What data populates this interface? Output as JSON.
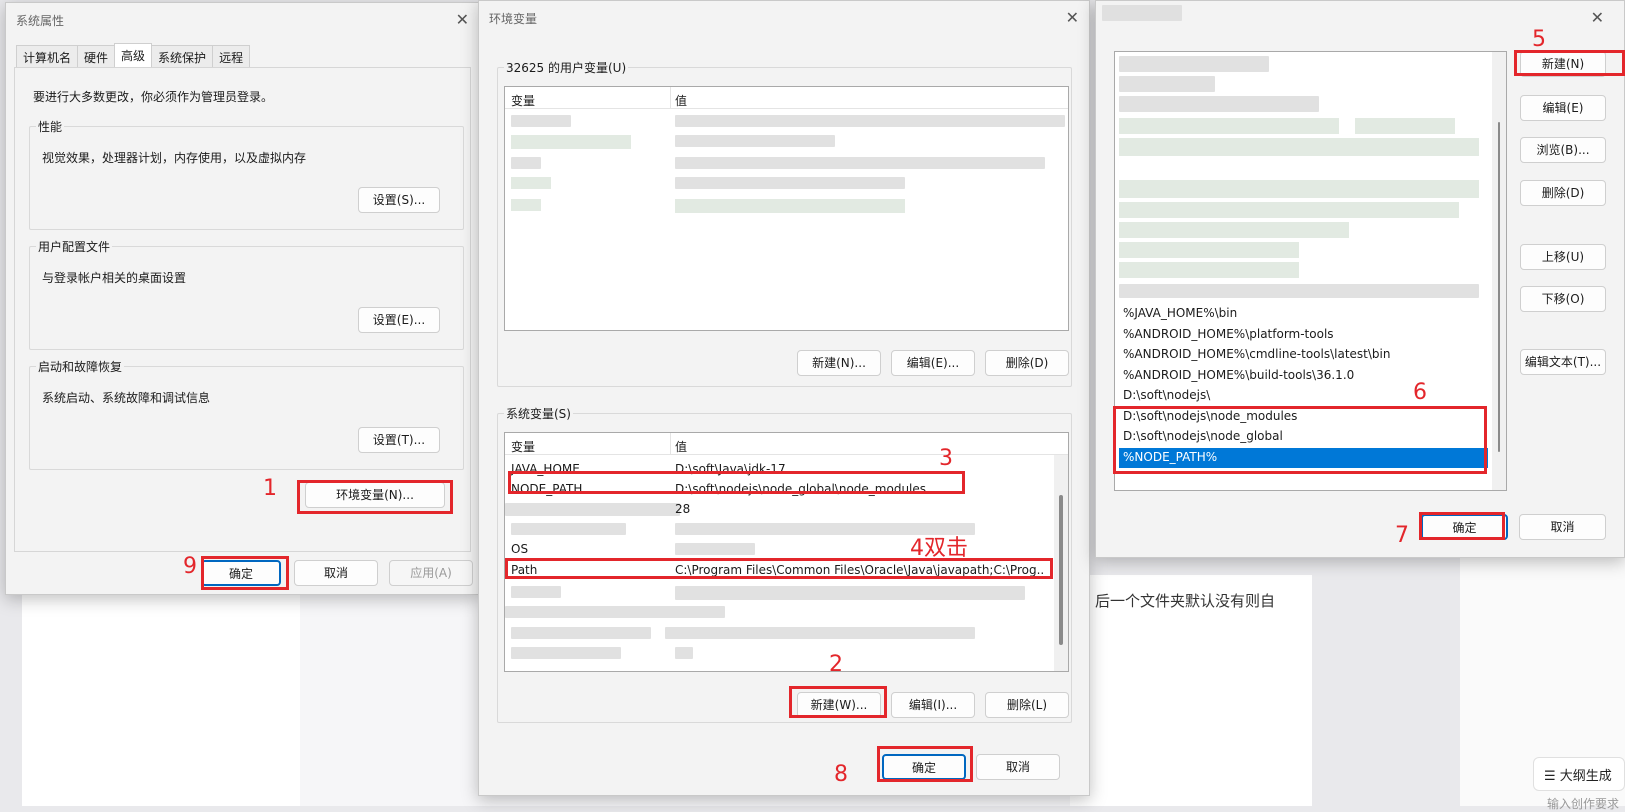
{
  "background": {
    "article_fragment": "后一个文件夹默认没有则自",
    "outline_button": "大纲生成",
    "outline_input": "输入创作要求"
  },
  "sysprops": {
    "title": "系统属性",
    "tabs": [
      "计算机名",
      "硬件",
      "高级",
      "系统保护",
      "远程"
    ],
    "notice": "要进行大多数更改，你必须作为管理员登录。",
    "perf": {
      "label": "性能",
      "desc": "视觉效果，处理器计划，内存使用，以及虚拟内存",
      "button": "设置(S)..."
    },
    "profile": {
      "label": "用户配置文件",
      "desc": "与登录帐户相关的桌面设置",
      "button": "设置(E)..."
    },
    "startup": {
      "label": "启动和故障恢复",
      "desc": "系统启动、系统故障和调试信息",
      "button": "设置(T)..."
    },
    "env_button": "环境变量(N)...",
    "ok": "确定",
    "cancel": "取消",
    "apply": "应用(A)"
  },
  "envvars": {
    "title": "环境变量",
    "user_group": "32625 的用户变量(U)",
    "sys_group": "系统变量(S)",
    "col_var": "变量",
    "col_val": "值",
    "user_buttons": [
      "新建(N)...",
      "编辑(E)...",
      "删除(D)"
    ],
    "sys_rows": [
      {
        "var": "JAVA_HOME",
        "val": "D:\\soft\\Java\\jdk-17"
      },
      {
        "var": "NODE_PATH",
        "val": "D:\\soft\\nodejs\\node_global\\node_modules"
      },
      {
        "var": "",
        "val": "28"
      },
      {
        "var": "",
        "val": ""
      },
      {
        "var": "OS",
        "val": ""
      },
      {
        "var": "Path",
        "val": "C:\\Program Files\\Common Files\\Oracle\\Java\\javapath;C:\\Prog..."
      }
    ],
    "sys_buttons": [
      "新建(W)...",
      "编辑(I)...",
      "删除(L)"
    ],
    "ok": "确定",
    "cancel": "取消"
  },
  "editpath": {
    "rows": [
      "%JAVA_HOME%\\bin",
      "%ANDROID_HOME%\\platform-tools",
      "%ANDROID_HOME%\\cmdline-tools\\latest\\bin",
      "%ANDROID_HOME%\\build-tools\\36.1.0",
      "D:\\soft\\nodejs\\",
      "D:\\soft\\nodejs\\node_modules",
      "D:\\soft\\nodejs\\node_global",
      "%NODE_PATH%"
    ],
    "buttons": [
      "新建(N)",
      "编辑(E)",
      "浏览(B)...",
      "删除(D)",
      "上移(U)",
      "下移(O)",
      "编辑文本(T)..."
    ],
    "ok": "确定",
    "cancel": "取消"
  },
  "annotations": [
    "1",
    "2",
    "3",
    "4双击",
    "5",
    "6",
    "7",
    "8",
    "9"
  ],
  "colors": {
    "annotation": "#e3262b",
    "selection": "#0078d7"
  }
}
